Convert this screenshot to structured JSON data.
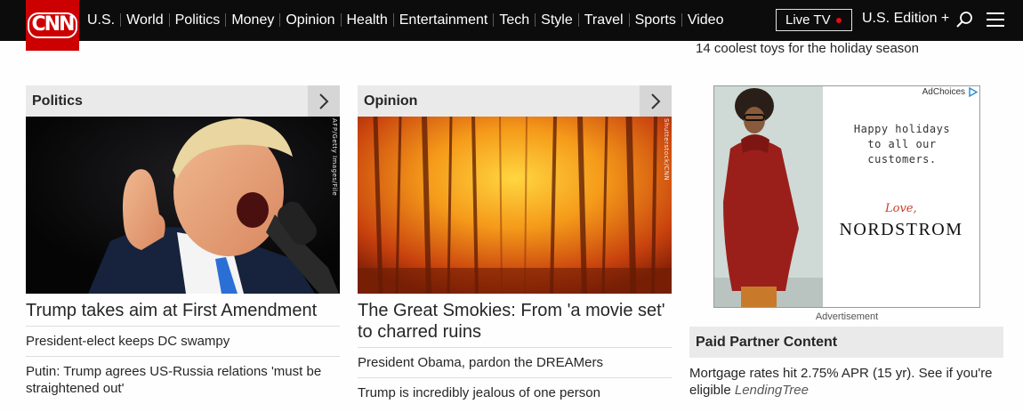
{
  "nav": {
    "logo": "CNN",
    "links": [
      "U.S.",
      "World",
      "Politics",
      "Money",
      "Opinion",
      "Health",
      "Entertainment",
      "Tech",
      "Style",
      "Travel",
      "Sports",
      "Video"
    ],
    "live_tv": "Live TV",
    "edition": "U.S. Edition +",
    "icons": [
      "search-icon",
      "menu-icon"
    ]
  },
  "top_link": "14 coolest toys for the holiday season",
  "politics": {
    "title": "Politics",
    "credit": "AFP/Getty Images/File",
    "headline": "Trump takes aim at First Amendment",
    "items": [
      "President-elect keeps DC swampy",
      "Putin: Trump agrees US-Russia relations 'must be straightened out'"
    ]
  },
  "opinion": {
    "title": "Opinion",
    "credit": "Shutterstock/CNN",
    "headline": "The Great Smokies: From 'a movie set' to charred ruins",
    "items": [
      "President Obama, pardon the DREAMers",
      "Trump is incredibly jealous of one person"
    ]
  },
  "ad": {
    "choices": "AdChoices",
    "line1": "Happy holidays",
    "line2": "to all our",
    "line3": "customers.",
    "love": "Love,",
    "brand": "NORDSTROM",
    "label": "Advertisement"
  },
  "paid": {
    "title": "Paid Partner Content",
    "item": "Mortgage rates hit 2.75% APR (15 yr). See if you're eligible",
    "sponsor": "LendingTree"
  },
  "colors": {
    "brand_red": "#cc0000",
    "nav_bg": "#0c0c0c",
    "header_gray": "#eaeaea"
  }
}
